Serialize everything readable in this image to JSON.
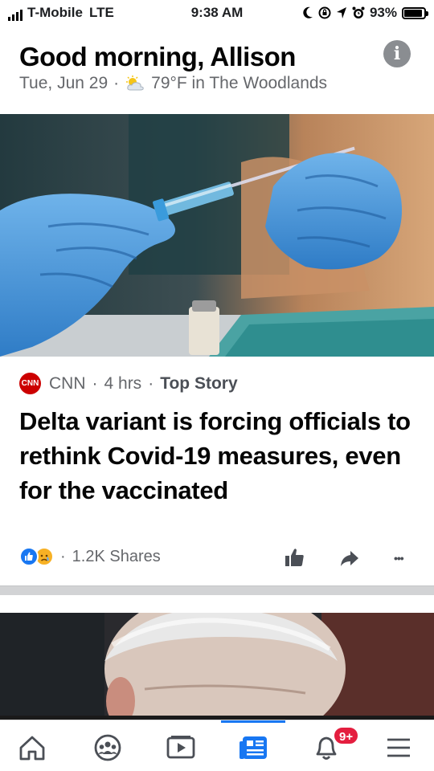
{
  "status_bar": {
    "carrier": "T-Mobile",
    "network": "LTE",
    "time": "9:38 AM",
    "battery_percent": "93%",
    "battery_level": 0.93,
    "icons": [
      "moon-icon",
      "lock-rotation-icon",
      "location-icon",
      "alarm-icon"
    ]
  },
  "header": {
    "greeting": "Good morning, Allison",
    "date": "Tue, Jun 29",
    "separator": "·",
    "weather": "79°F in The Woodlands",
    "weather_icon": "partly-cloudy-icon",
    "info_icon_glyph": "i"
  },
  "story": {
    "source": "CNN",
    "source_logo_text": "CNN",
    "age": "4 hrs",
    "tag": "Top Story",
    "headline": "Delta variant is forcing officials to rethink Covid-19 measures, even for the vaccinated",
    "shares": "1.2K Shares",
    "reactions": [
      "like",
      "sad"
    ],
    "more_glyph": "•••"
  },
  "nav": {
    "items": [
      "home",
      "groups",
      "watch",
      "news",
      "notifications",
      "menu"
    ],
    "active": "news",
    "notification_badge": "9+"
  },
  "colors": {
    "accent": "#1877f2",
    "badge": "#e41e3f",
    "cnn_red": "#cc0000",
    "secondary_text": "#65676b"
  }
}
